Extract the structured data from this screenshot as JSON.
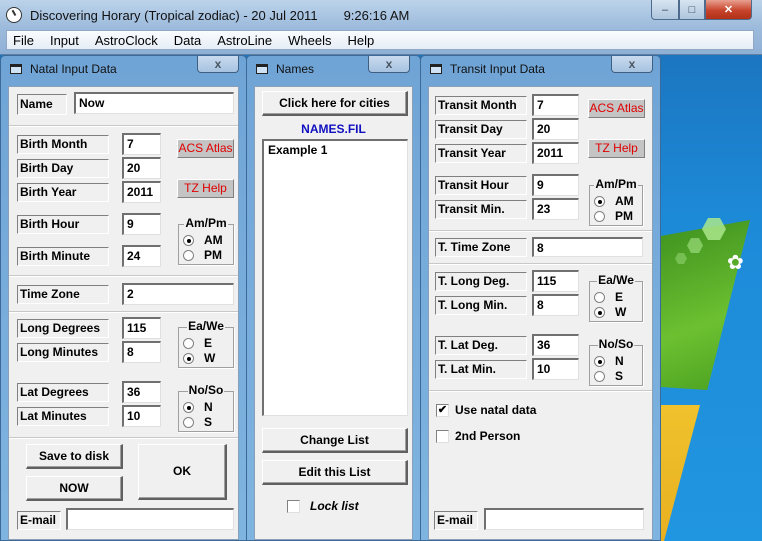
{
  "window": {
    "title": "Discovering Horary (Tropical zodiac) - 20 Jul 2011",
    "time": "9:26:16 AM",
    "controls": {
      "minimize": "–",
      "maximize": "□",
      "close": "✕"
    }
  },
  "menu": [
    "File",
    "Input",
    "AstroClock",
    "Data",
    "AstroLine",
    "Wheels",
    "Help"
  ],
  "natal": {
    "title": "Natal Input Data",
    "close": "x",
    "name_label": "Name",
    "name_value": "Now",
    "birth_month_label": "Birth Month",
    "birth_month": "7",
    "birth_day_label": "Birth Day",
    "birth_day": "20",
    "birth_year_label": "Birth Year",
    "birth_year": "2011",
    "acs_atlas": "ACS Atlas",
    "tz_help": "TZ Help",
    "birth_hour_label": "Birth Hour",
    "birth_hour": "9",
    "birth_minute_label": "Birth Minute",
    "birth_minute": "24",
    "ampm": {
      "title": "Am/Pm",
      "options": [
        "AM",
        "PM"
      ],
      "selected": "AM"
    },
    "time_zone_label": "Time Zone",
    "time_zone": "2",
    "long_deg_label": "Long Degrees",
    "long_deg": "115",
    "long_min_label": "Long Minutes",
    "long_min": "8",
    "eawe": {
      "title": "Ea/We",
      "options": [
        "E",
        "W"
      ],
      "selected": "W"
    },
    "lat_deg_label": "Lat Degrees",
    "lat_deg": "36",
    "lat_min_label": "Lat Minutes",
    "lat_min": "10",
    "noso": {
      "title": "No/So",
      "options": [
        "N",
        "S"
      ],
      "selected": "N"
    },
    "save_button": "Save to disk",
    "now_button": "NOW",
    "ok_button": "OK",
    "email_label": "E-mail",
    "email_value": ""
  },
  "names": {
    "title": "Names",
    "close": "x",
    "cities_button": "Click here for cities",
    "file_label": "NAMES.FIL",
    "list_items": [
      "Example 1"
    ],
    "change_list_button": "Change List",
    "edit_list_button": "Edit this List",
    "lock_list_label": "Lock list",
    "lock_list_checked": false,
    "file_label_color": "#1010c0"
  },
  "transit": {
    "title": "Transit Input Data",
    "close": "x",
    "month_label": "Transit Month",
    "month": "7",
    "day_label": "Transit Day",
    "day": "20",
    "year_label": "Transit Year",
    "year": "2011",
    "acs_atlas": "ACS Atlas",
    "tz_help": "TZ Help",
    "hour_label": "Transit Hour",
    "hour": "9",
    "min_label": "Transit Min.",
    "min": "23",
    "ampm": {
      "title": "Am/Pm",
      "options": [
        "AM",
        "PM"
      ],
      "selected": "AM"
    },
    "tz_label": "T. Time Zone",
    "tz": "8",
    "long_deg_label": "T. Long Deg.",
    "long_deg": "115",
    "long_min_label": "T. Long Min.",
    "long_min": "8",
    "eawe": {
      "title": "Ea/We",
      "options": [
        "E",
        "W"
      ],
      "selected": "W"
    },
    "lat_deg_label": "T. Lat Deg.",
    "lat_deg": "36",
    "lat_min_label": "T. Lat Min.",
    "lat_min": "10",
    "noso": {
      "title": "No/So",
      "options": [
        "N",
        "S"
      ],
      "selected": "N"
    },
    "use_natal_label": "Use natal data",
    "use_natal_checked": true,
    "second_person_label": "2nd Person",
    "second_person_checked": false,
    "email_label": "E-mail",
    "email_value": ""
  }
}
